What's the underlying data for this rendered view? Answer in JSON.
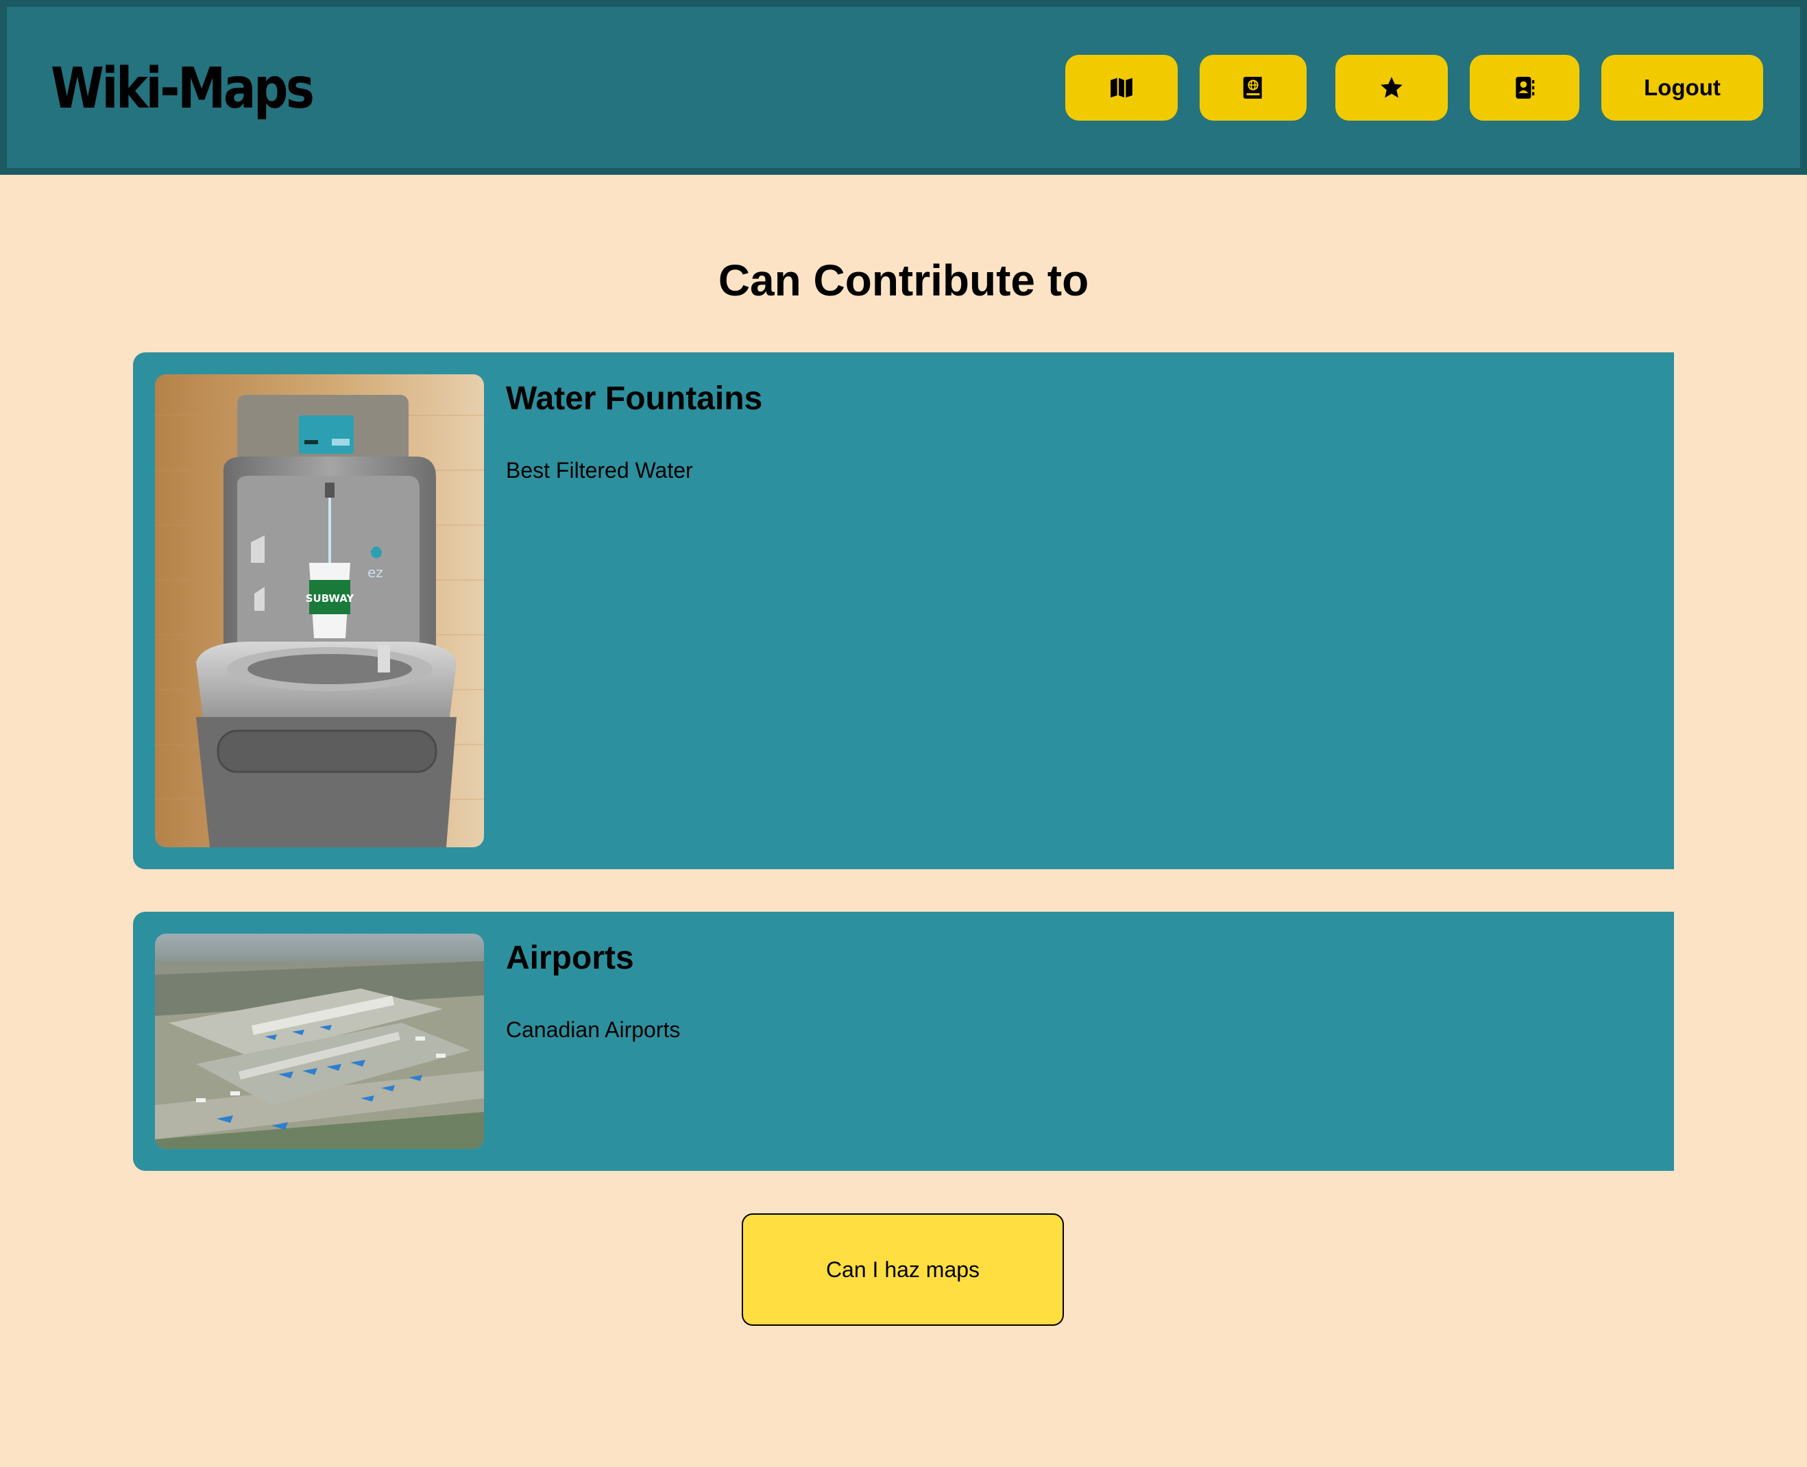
{
  "header": {
    "brand": "Wiki-Maps",
    "nav": [
      {
        "icon": "map-icon"
      },
      {
        "icon": "atlas-book-icon"
      },
      {
        "icon": "star-icon"
      },
      {
        "icon": "contact-book-icon"
      }
    ],
    "logout_label": "Logout"
  },
  "main": {
    "section_title": "Can Contribute to",
    "maps": [
      {
        "title": "Water Fountains",
        "description": "Best Filtered Water",
        "image": "water-fountain-photo"
      },
      {
        "title": "Airports",
        "description": "Canadian Airports",
        "image": "airport-aerial-photo"
      }
    ],
    "cta_label": "Can I haz maps"
  },
  "colors": {
    "header_bg": "#24737f",
    "page_bg": "#fde3c5",
    "card_bg": "#2d909e",
    "button_yellow": "#f2ca00",
    "cta_yellow": "#ffde42"
  }
}
